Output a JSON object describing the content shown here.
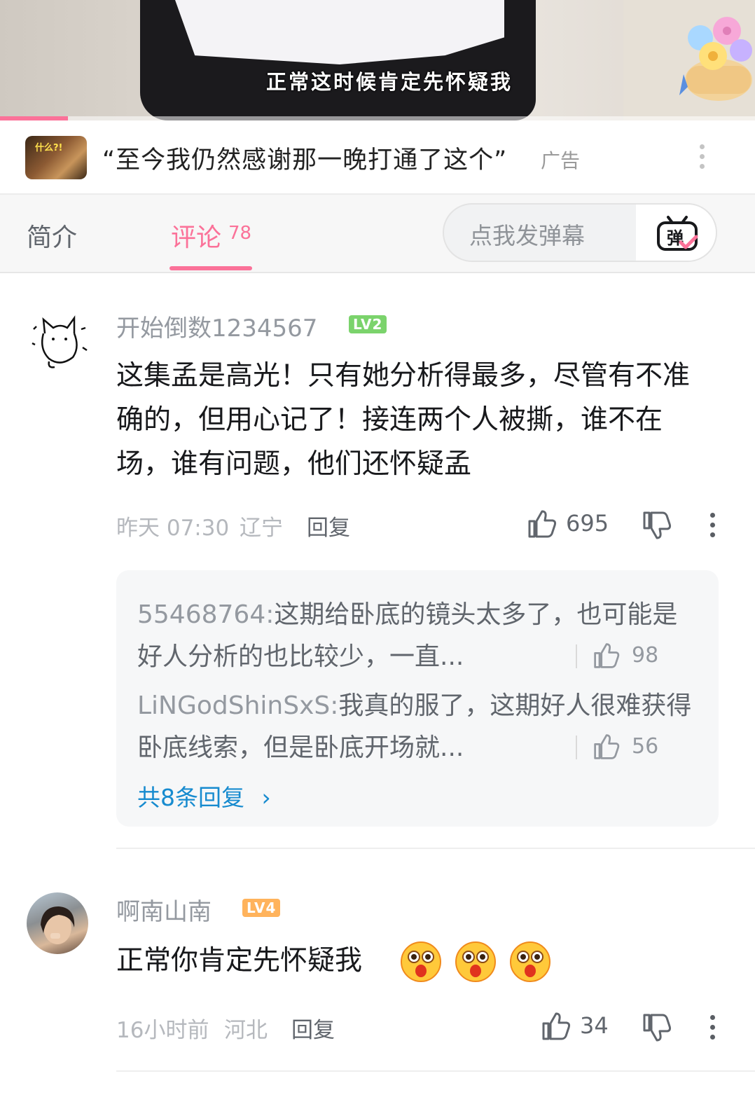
{
  "video": {
    "subtitle": "正常这时候肯定先怀疑我",
    "progress_fraction": 0.09
  },
  "ad": {
    "thumb_tag": "什么?!",
    "title": "“至今我仍然感谢那一晚打通了这个”",
    "label": "广告"
  },
  "tabs": {
    "intro": "简介",
    "comments": "评论",
    "comments_count": "78",
    "danmaku_placeholder": "点我发弹幕",
    "danmaku_icon_text": "弹"
  },
  "comments": [
    {
      "username": "开始倒数1234567",
      "level": "LV2",
      "level_color": "#7bd36c",
      "text": "这集孟是高光！只有她分析得最多，尽管有不准确的，但用心记了！接连两个人被撕，谁不在场，谁有问题，他们还怀疑孟",
      "time": "昨天 07:30",
      "location": "辽宁",
      "reply_label": "回复",
      "likes": "695",
      "replies": [
        {
          "name": "55468764:",
          "text": "这期给卧底的镜头太多了，也可能是好人分析的也比较少，一直...",
          "likes": "98"
        },
        {
          "name": "LiNGodShinSxS:",
          "text": "我真的服了，这期好人很难获得卧底线索，但是卧底开场就...",
          "likes": "56"
        }
      ],
      "replies_more": "共8条回复"
    },
    {
      "username": "啊南山南",
      "level": "LV4",
      "level_color": "#ffb35c",
      "text": "正常你肯定先怀疑我",
      "time": "16小时前",
      "location": "河北",
      "reply_label": "回复",
      "likes": "34"
    }
  ],
  "colors": {
    "accent": "#fb7299",
    "link": "#178bcf"
  }
}
